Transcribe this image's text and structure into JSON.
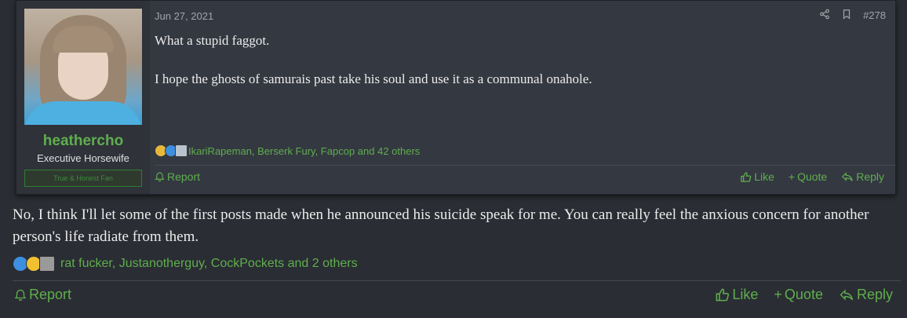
{
  "quoted_post": {
    "user": {
      "name": "heathercho",
      "title": "Executive Horsewife",
      "banner": "True & Honest Fan"
    },
    "date": "Jun 27, 2021",
    "post_number": "#278",
    "paragraphs": [
      "What a stupid faggot.",
      "I hope the ghosts of samurais past take his soul and use it as a communal onahole."
    ],
    "reactions_text": "IkariRapeman, Berserk Fury, Fapcop and 42 others",
    "report_label": "Report",
    "like_label": "Like",
    "quote_label": "Quote",
    "reply_label": "Reply"
  },
  "post": {
    "text": "No, I think I'll let some of the first posts made when he announced his suicide speak for me. You can really feel the anxious concern for another person's life radiate from them.",
    "reactions_text": "rat fucker, Justanotherguy, CockPockets and 2 others",
    "report_label": "Report",
    "like_label": "Like",
    "quote_label": "Quote",
    "reply_label": "Reply"
  },
  "colors": {
    "background": "#2a2d33",
    "panel": "#343841",
    "accent_green": "#5fae4e",
    "text": "#ececec"
  },
  "icons": [
    "share-icon",
    "bookmark-icon",
    "report-icon",
    "like-icon",
    "quote-icon",
    "reply-icon"
  ]
}
